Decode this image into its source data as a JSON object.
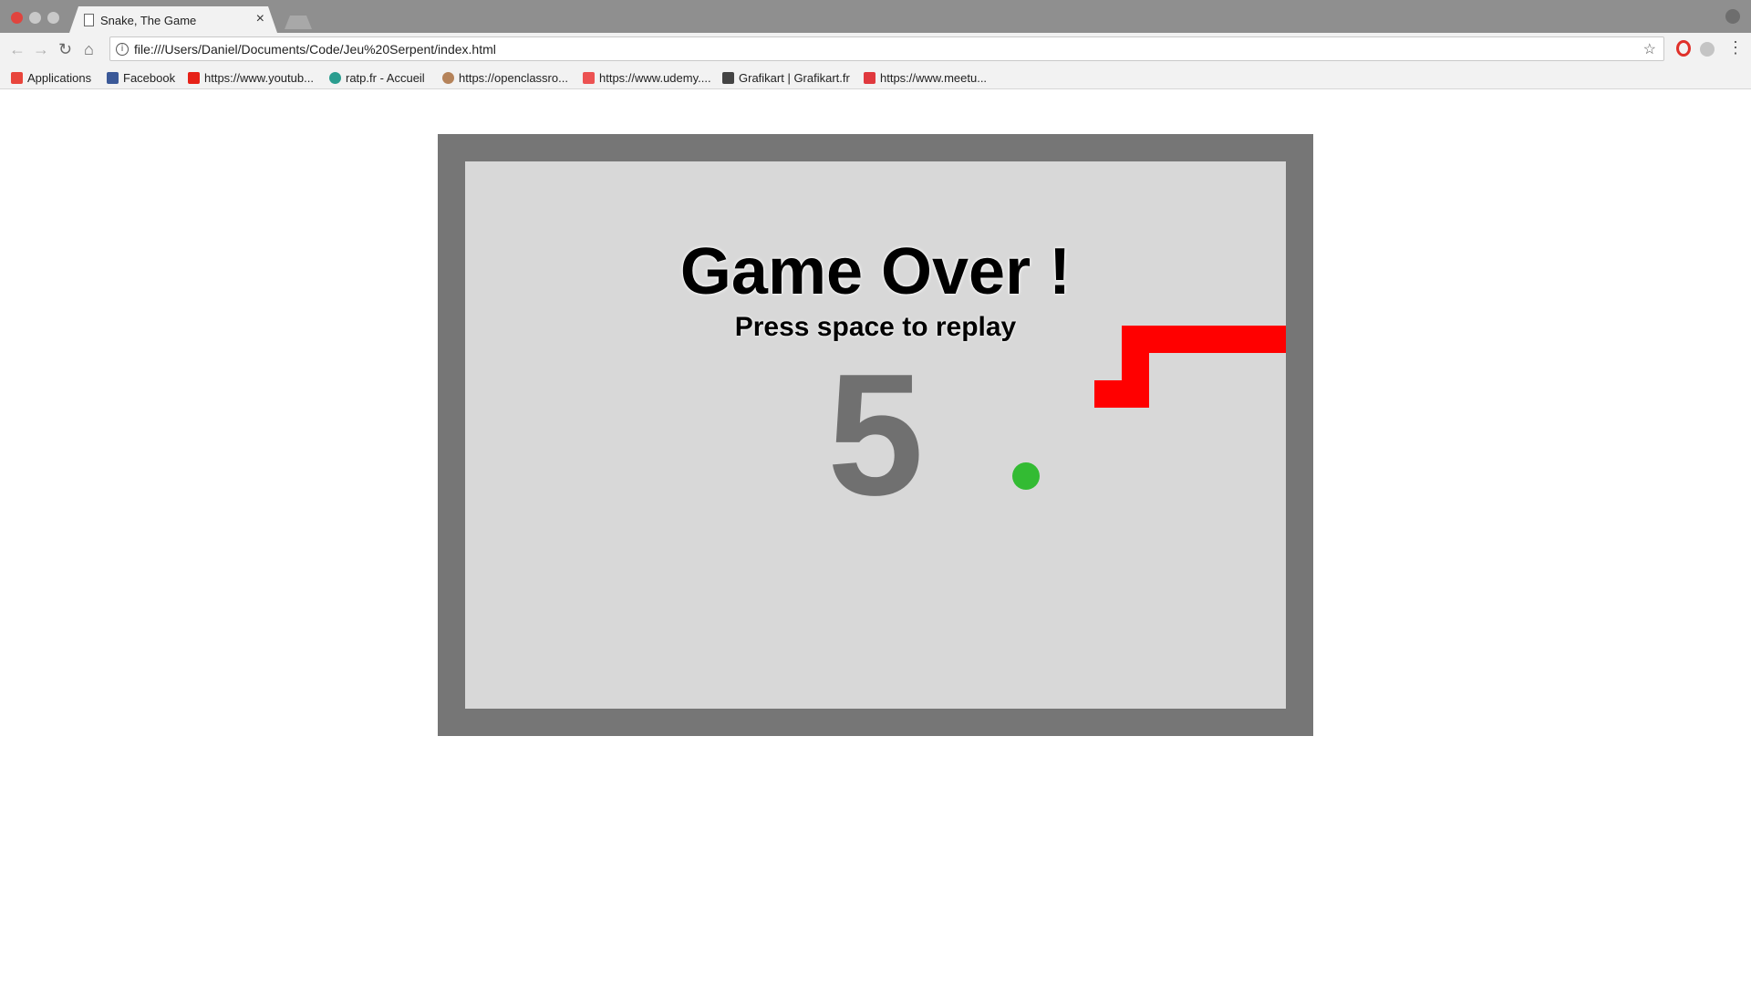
{
  "browser": {
    "tab": {
      "title": "Snake, The Game",
      "close": "×"
    },
    "address": {
      "url": "file:///Users/Daniel/Documents/Code/Jeu%20Serpent/index.html"
    },
    "nav": {
      "back": "←",
      "forward": "→",
      "reload": "↻",
      "home": "⌂",
      "star": "☆",
      "menu": "⋮",
      "info": "i"
    },
    "bookmarks": [
      {
        "label": "Applications",
        "icon": "apps-grid-icon",
        "color": "#e8453c"
      },
      {
        "label": "Facebook",
        "icon": "facebook-icon",
        "color": "#3b5998"
      },
      {
        "label": "https://www.youtub...",
        "icon": "youtube-icon",
        "color": "#e62117"
      },
      {
        "label": "ratp.fr - Accueil",
        "icon": "ratp-icon",
        "color": "#2a9d8f"
      },
      {
        "label": "https://openclassro...",
        "icon": "openclassrooms-icon",
        "color": "#b5835a"
      },
      {
        "label": "https://www.udemy....",
        "icon": "udemy-icon",
        "color": "#ec5252"
      },
      {
        "label": "Grafikart | Grafikart.fr",
        "icon": "grafikart-icon",
        "color": "#444444"
      },
      {
        "label": "https://www.meetu...",
        "icon": "meetup-icon",
        "color": "#e0393e"
      }
    ]
  },
  "game": {
    "title": "Game Over !",
    "subtitle": "Press space to replay",
    "score": "5",
    "colors": {
      "frame": "#767676",
      "board": "#d8d8d8",
      "snake": "#ff0000",
      "apple": "#33bb33",
      "score": "#707070"
    },
    "grid_size": [
      30,
      20
    ],
    "snake_cells": [
      [
        29,
        6
      ],
      [
        28,
        6
      ],
      [
        27,
        6
      ],
      [
        26,
        6
      ],
      [
        25,
        6
      ],
      [
        24,
        6
      ],
      [
        24,
        7
      ],
      [
        24,
        8
      ],
      [
        23,
        8
      ]
    ],
    "apple_cell": [
      20,
      11
    ]
  }
}
